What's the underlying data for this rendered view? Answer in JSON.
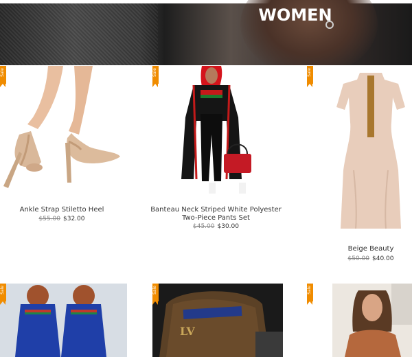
{
  "hero": {
    "title": "WOMEN"
  },
  "badge_label": "Sale",
  "products": [
    {
      "name": "Ankle Strap Stiletto Heel",
      "old_price": "$55.00",
      "price": "$32.00"
    },
    {
      "name": "Banteau Neck Striped White Polyester Two-Piece Pants Set",
      "old_price": "$45.00",
      "price": "$30.00"
    },
    {
      "name": "Beige Beauty",
      "old_price": "$50.00",
      "price": "$40.00"
    }
  ],
  "colors": {
    "badge": "#f08c00",
    "text": "#333333",
    "strike": "#888888"
  }
}
